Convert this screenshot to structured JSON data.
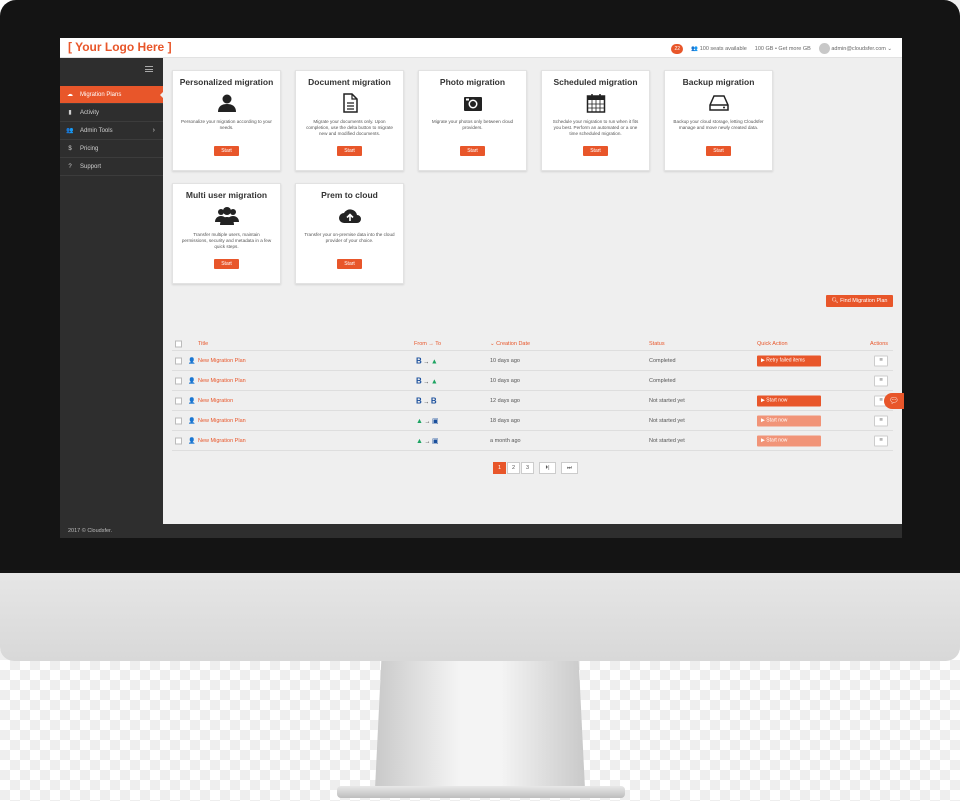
{
  "brand": {
    "logo": "[ Your Logo Here ]",
    "accent": "#e8562a"
  },
  "topbar": {
    "notif_count": "22",
    "seats": "100 seats available",
    "storage": "100 GB • Get more GB",
    "user": "admin@cloudsfer.com"
  },
  "sidebar": {
    "items": [
      {
        "label": "Migration Plans",
        "icon": "cloud-icon"
      },
      {
        "label": "Activity",
        "icon": "bar-chart-icon"
      },
      {
        "label": "Admin Tools",
        "icon": "users-icon"
      },
      {
        "label": "Pricing",
        "icon": "dollar-icon"
      },
      {
        "label": "Support",
        "icon": "question-icon"
      }
    ]
  },
  "cards": [
    {
      "title": "Personalized migration",
      "icon": "user-icon",
      "desc": "Personalize your migration according to your needs.",
      "button": "Start"
    },
    {
      "title": "Document migration",
      "icon": "document-icon",
      "desc": "Migrate your documents only. Upon completion, use the delta button to migrate new and modified documents.",
      "button": "Start"
    },
    {
      "title": "Photo migration",
      "icon": "camera-icon",
      "desc": "Migrate your photos only between cloud providers.",
      "button": "Start"
    },
    {
      "title": "Scheduled migration",
      "icon": "calendar-icon",
      "desc": "Schedule your migration to run when it fits you best. Perform an automated or a one time scheduled migration.",
      "button": "Start"
    },
    {
      "title": "Backup migration",
      "icon": "hard-drive-icon",
      "desc": "Backup your cloud storage, letting Cloudsfer manage and move newly created data.",
      "button": "Start"
    },
    {
      "title": "Multi user migration",
      "icon": "group-icon",
      "desc": "Transfer multiple users, maintain permissions, security and metadata in a few quick steps.",
      "button": "Start"
    },
    {
      "title": "Prem to cloud",
      "icon": "cloud-upload-icon",
      "desc": "Transfer your on-premise data into the cloud provider of your choice.",
      "button": "Start"
    }
  ],
  "find_button": "Find Migration Plan",
  "table": {
    "headers": {
      "title": "Title",
      "from_to": "From → To",
      "created": "Creation Date",
      "status": "Status",
      "quick": "Quick Action",
      "actions": "Actions"
    },
    "rows": [
      {
        "title": "New Migration Plan",
        "from": "B",
        "to": "gdrive",
        "created": "10 days ago",
        "status": "Completed",
        "action": "Retry failed items",
        "action_state": "on"
      },
      {
        "title": "New Migration Plan",
        "from": "B",
        "to": "gdrive",
        "created": "10 days ago",
        "status": "Completed",
        "action": "",
        "action_state": "none"
      },
      {
        "title": "New Migration",
        "from": "B",
        "to": "B",
        "created": "12 days ago",
        "status": "Not started yet",
        "action": "Start now",
        "action_state": "on"
      },
      {
        "title": "New Migration Plan",
        "from": "gdrive",
        "to": "box",
        "created": "18 days ago",
        "status": "Not started yet",
        "action": "Start now",
        "action_state": "dim"
      },
      {
        "title": "New Migration Plan",
        "from": "gdrive",
        "to": "box",
        "created": "a month ago",
        "status": "Not started yet",
        "action": "Start now",
        "action_state": "dim"
      }
    ]
  },
  "pagination": {
    "pages": [
      "1",
      "2",
      "3"
    ],
    "next": "⏵|",
    "last": "⏭"
  },
  "footer": "2017 © Cloudsfer."
}
